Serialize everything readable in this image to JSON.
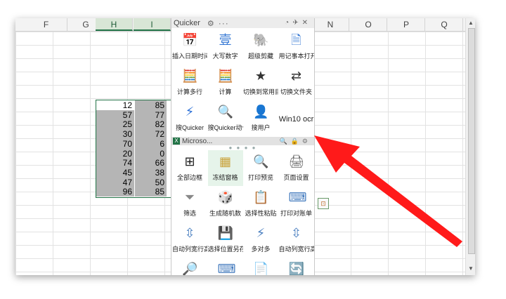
{
  "spreadsheet": {
    "columns": [
      {
        "label": "F",
        "sel": false
      },
      {
        "label": "G",
        "sel": false
      },
      {
        "label": "H",
        "sel": true
      },
      {
        "label": "I",
        "sel": true
      },
      {
        "label": "",
        "sel": false
      },
      {
        "label": "",
        "sel": false
      },
      {
        "label": "",
        "sel": false
      },
      {
        "label": "",
        "sel": false
      },
      {
        "label": "N",
        "sel": false
      },
      {
        "label": "O",
        "sel": false
      },
      {
        "label": "P",
        "sel": false
      },
      {
        "label": "Q",
        "sel": false
      }
    ],
    "col_h_values": [
      "12",
      "57",
      "25",
      "30",
      "70",
      "20",
      "74",
      "45",
      "47",
      "96"
    ],
    "col_i_values": [
      "85",
      "77",
      "82",
      "72",
      "6",
      "0",
      "66",
      "38",
      "50",
      "85"
    ]
  },
  "quicker": {
    "title": "Quicker",
    "gear": "⚙",
    "more": "···",
    "title_icons": [
      "◔",
      "✈",
      "✕"
    ],
    "top_actions": [
      {
        "name": "insert-datetime",
        "icon": "📅",
        "label": "插入日期时间",
        "color": "#3a7bd5"
      },
      {
        "name": "uppercase-number",
        "icon": "壹",
        "label": "大写数字",
        "color": "#3a7bd5"
      },
      {
        "name": "super-clip",
        "icon": "🐘",
        "label": "超级剪藏",
        "color": "#2e8b3a"
      },
      {
        "name": "notepad-open",
        "icon": "🗎",
        "label": "用记事本打开",
        "color": "#3a7bd5"
      },
      {
        "name": "calc-multiline",
        "icon": "🧮",
        "label": "计算多行",
        "color": "#3a7bd5"
      },
      {
        "name": "calc",
        "icon": "🧮",
        "label": "计算",
        "color": "#3a7bd5"
      },
      {
        "name": "switch-common-dir",
        "icon": "★",
        "label": "切换到常用目录",
        "color": "#333333"
      },
      {
        "name": "switch-folder",
        "icon": "⇄",
        "label": "切换文件夹",
        "color": "#333333"
      },
      {
        "name": "search-quicker",
        "icon": "⚡",
        "label": "搜Quicker",
        "color": "#2b6fd6"
      },
      {
        "name": "search-quicker-action",
        "icon": "🔍",
        "label": "搜Quicker动作",
        "color": "#2b6fd6"
      },
      {
        "name": "search-user",
        "icon": "👤",
        "label": "搜用户",
        "color": "#2b6fd6"
      },
      {
        "name": "win10-ocr",
        "icon": "",
        "label": "Win10 ocr",
        "color": "#333333"
      }
    ],
    "app_title": "Microso...",
    "app_icons": [
      "🔍",
      "🔒",
      "⚙"
    ],
    "excel_actions": [
      {
        "name": "all-borders",
        "icon": "⊞",
        "label": "全部边框",
        "color": "#222222"
      },
      {
        "name": "freeze-panes",
        "icon": "▦",
        "label": "冻结窗格",
        "color": "#c9a23a"
      },
      {
        "name": "print-preview",
        "icon": "🔍",
        "label": "打印预览",
        "color": "#666666"
      },
      {
        "name": "page-setup",
        "icon": "🖨",
        "label": "页面设置",
        "color": "#666666"
      },
      {
        "name": "filter",
        "icon": "⏷",
        "label": "筛选",
        "color": "#888888"
      },
      {
        "name": "random-number",
        "icon": "🎲",
        "label": "生成随机数",
        "color": "#555555"
      },
      {
        "name": "paste-special",
        "icon": "📋",
        "label": "选择性粘贴",
        "color": "#4a7fc0"
      },
      {
        "name": "print-checklist",
        "icon": "⌨",
        "label": "打印对账单",
        "color": "#4a7fc0"
      },
      {
        "name": "autofit-row-height",
        "icon": "⇳",
        "label": "自动列宽行高",
        "color": "#4a7fc0"
      },
      {
        "name": "save-selection",
        "icon": "💾",
        "label": "选择位置另存",
        "color": "#4a7fc0"
      },
      {
        "name": "many-to-many",
        "icon": "⚡",
        "label": "多对多",
        "color": "#4a7fc0"
      },
      {
        "name": "autofit-col-width",
        "icon": "⇳",
        "label": "自动列宽行高",
        "color": "#4a7fc0"
      },
      {
        "name": "search-tool",
        "icon": "🔎",
        "label": "",
        "color": "#d35400"
      },
      {
        "name": "keyboard-tool",
        "icon": "⌨",
        "label": "",
        "color": "#4a7fc0"
      },
      {
        "name": "copy-tool",
        "icon": "📄",
        "label": "",
        "color": "#4a7fc0"
      },
      {
        "name": "refresh-tool",
        "icon": "🔄",
        "label": "",
        "color": "#2b6fd6"
      }
    ]
  },
  "colors": {
    "selection": "#217346",
    "arrow": "#ff1a1a",
    "cell_gray": "#b5b5b5"
  }
}
